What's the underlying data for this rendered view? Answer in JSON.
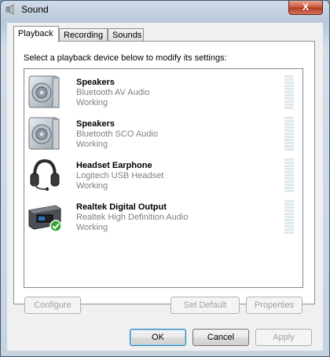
{
  "window": {
    "title": "Sound",
    "close_label": "X"
  },
  "tabs": [
    {
      "label": "Playback",
      "active": true
    },
    {
      "label": "Recording",
      "active": false
    },
    {
      "label": "Sounds",
      "active": false
    }
  ],
  "instruction": "Select a playback device below to modify its settings:",
  "devices": [
    {
      "name": "Speakers",
      "description": "Bluetooth AV Audio",
      "status": "Working",
      "icon": "speaker-icon"
    },
    {
      "name": "Speakers",
      "description": "Bluetooth SCO Audio",
      "status": "Working",
      "icon": "speaker-icon"
    },
    {
      "name": "Headset Earphone",
      "description": "Logitech USB Headset",
      "status": "Working",
      "icon": "headset-icon"
    },
    {
      "name": "Realtek Digital Output",
      "description": "Realtek High Definition Audio",
      "status": "Working",
      "icon": "digital-output-icon"
    }
  ],
  "buttons": {
    "configure": "Configure",
    "set_default": "Set Default",
    "properties": "Properties",
    "ok": "OK",
    "cancel": "Cancel",
    "apply": "Apply"
  },
  "colors": {
    "accent": "#3c7fb1",
    "status_ok": "#2fa82f",
    "meter": "#dfe8ed"
  }
}
